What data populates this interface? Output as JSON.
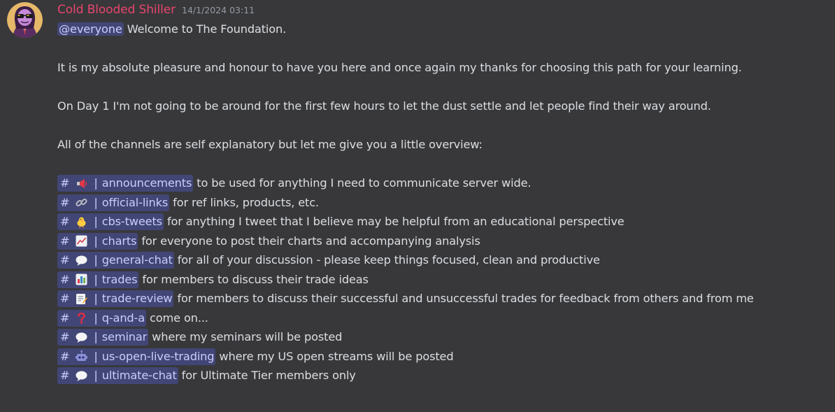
{
  "message": {
    "author": "Cold Blooded Shiller",
    "timestamp": "14/1/2024 03:11",
    "author_color": "#e9456c",
    "mention": "@everyone",
    "intro": " Welcome to The Foundation.",
    "paragraphs": [
      "It is my absolute pleasure and honour to have you here and once again my thanks for choosing this path for your learning.",
      "On Day 1 I'm not going to be around for the first few hours to let the dust settle and let people find their way around.",
      "All of the channels are self explanatory but let me give you a little overview:"
    ],
    "channels": [
      {
        "hash": "#",
        "emoji": "loudspeaker-icon",
        "pipe": "|",
        "name": "announcements",
        "description": " to be used for anything I need to communicate server wide."
      },
      {
        "hash": "#",
        "emoji": "link-icon",
        "pipe": "|",
        "name": "official-links",
        "description": " for ref links, products, etc."
      },
      {
        "hash": "#",
        "emoji": "chick-icon",
        "pipe": "|",
        "name": "cbs-tweets",
        "description": " for anything I tweet that I believe may be helpful from an educational perspective"
      },
      {
        "hash": "#",
        "emoji": "chart-up-icon",
        "pipe": "|",
        "name": "charts",
        "description": " for everyone to post their charts and accompanying analysis"
      },
      {
        "hash": "#",
        "emoji": "speech-bubble-icon",
        "pipe": "|",
        "name": "general-chat",
        "description": " for all of your discussion - please keep things focused, clean and productive"
      },
      {
        "hash": "#",
        "emoji": "bar-chart-icon",
        "pipe": "|",
        "name": "trades",
        "description": " for members to discuss their trade ideas"
      },
      {
        "hash": "#",
        "emoji": "memo-icon",
        "pipe": "|",
        "name": "trade-review",
        "description": " for members to discuss their successful and unsuccessful trades for feedback from others and from me"
      },
      {
        "hash": "#",
        "emoji": "question-icon",
        "pipe": "|",
        "name": "q-and-a",
        "description": " come on..."
      },
      {
        "hash": "#",
        "emoji": "speech-bubble-icon",
        "pipe": "|",
        "name": "seminar",
        "description": " where my seminars will be posted"
      },
      {
        "hash": "#",
        "emoji": "robot-icon",
        "pipe": "|",
        "name": "us-open-live-trading",
        "description": " where my US open streams will be posted"
      },
      {
        "hash": "#",
        "emoji": "speech-bubble-icon",
        "pipe": "|",
        "name": "ultimate-chat",
        "description": " for Ultimate Tier members only"
      }
    ]
  }
}
